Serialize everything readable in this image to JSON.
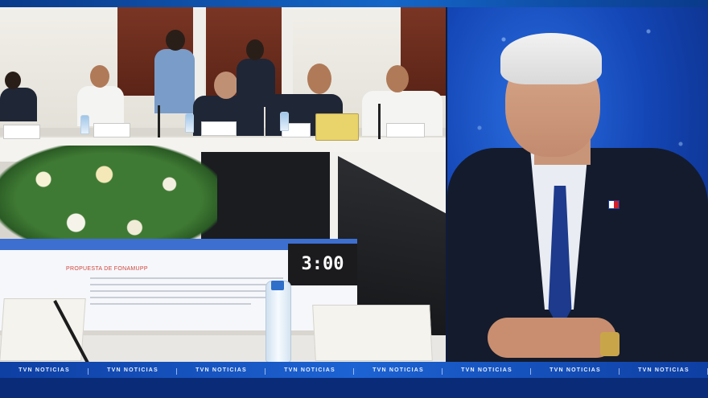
{
  "screen": {
    "timer": "3:00",
    "document_heading": "PROPUESTA DE FONAMUPP"
  },
  "ticker": {
    "items": [
      "TVN NOTICIAS",
      "TVN NOTICIAS",
      "TVN NOTICIAS",
      "TVN NOTICIAS",
      "TVN NOTICIAS",
      "TVN NOTICIAS",
      "TVN NOTICIAS",
      "TVN NOTICIAS"
    ]
  },
  "colors": {
    "ticker_bg": "#1d63d3",
    "studio_bg": "#1446b6",
    "timer_bg": "#1b1b1d",
    "document_heading": "#d0453a"
  }
}
